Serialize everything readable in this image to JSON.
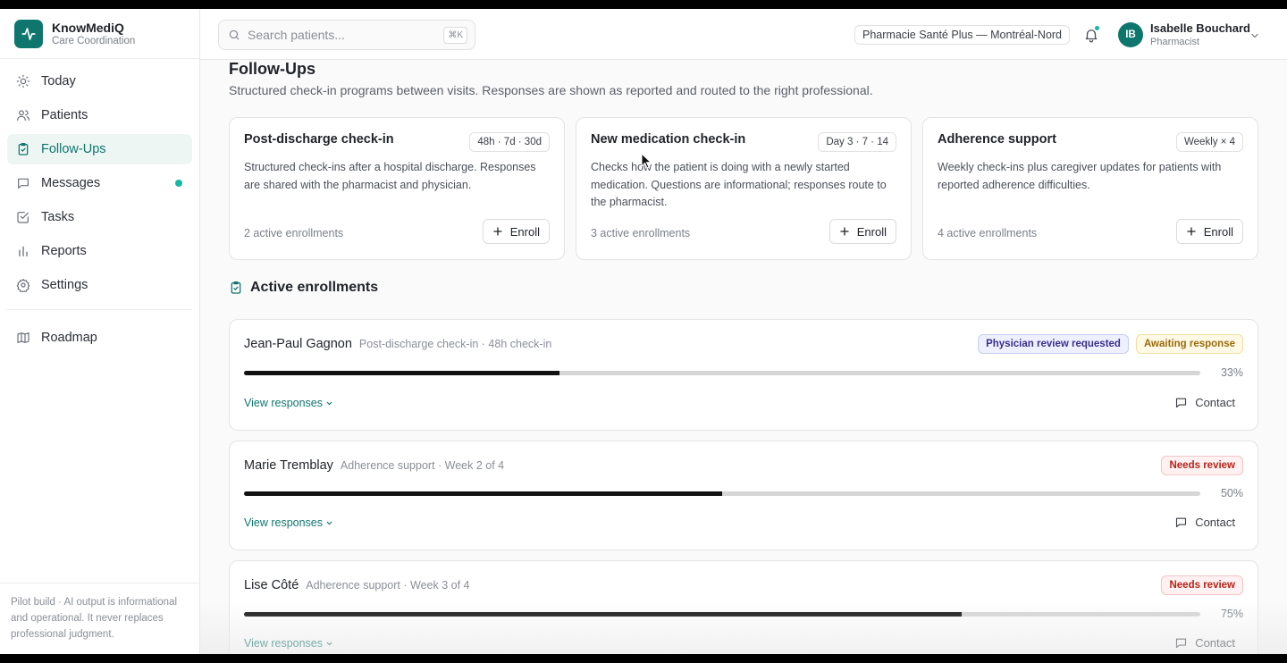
{
  "brand": {
    "name": "KnowMediQ",
    "subtitle": "Care Coordination"
  },
  "sidebar": {
    "items": [
      {
        "label": "Today",
        "icon": "sun-icon"
      },
      {
        "label": "Patients",
        "icon": "users-icon"
      },
      {
        "label": "Follow-Ups",
        "icon": "clipboard-check-icon",
        "active": true
      },
      {
        "label": "Messages",
        "icon": "message-icon",
        "dot": true
      },
      {
        "label": "Tasks",
        "icon": "check-square-icon"
      },
      {
        "label": "Reports",
        "icon": "bar-chart-icon"
      },
      {
        "label": "Settings",
        "icon": "gear-icon"
      }
    ],
    "secondary": [
      {
        "label": "Roadmap",
        "icon": "map-icon"
      }
    ],
    "footer_note": "Pilot build · AI output is informational and operational. It never replaces professional judgment."
  },
  "header": {
    "search_placeholder": "Search patients...",
    "search_shortcut": "⌘K",
    "pharmacy": "Pharmacie Santé Plus — Montréal-Nord",
    "user": {
      "initials": "IB",
      "name": "Isabelle Bouchard",
      "role": "Pharmacist"
    }
  },
  "page": {
    "title": "Follow-Ups",
    "subtitle": "Structured check-in programs between visits. Responses are shown as reported and routed to the right professional."
  },
  "programs": [
    {
      "title": "Post-discharge check-in",
      "badge": "48h · 7d · 30d",
      "description": "Structured check-ins after a hospital discharge. Responses are shared with the pharmacist and physician.",
      "count": "2 active enrollments",
      "button": "Enroll"
    },
    {
      "title": "New medication check-in",
      "badge": "Day 3 · 7 · 14",
      "description": "Checks how the patient is doing with a newly started medication. Questions are informational; responses route to the pharmacist.",
      "count": "3 active enrollments",
      "button": "Enroll"
    },
    {
      "title": "Adherence support",
      "badge": "Weekly × 4",
      "description": "Weekly check-ins plus caregiver updates for patients with reported adherence difficulties.",
      "count": "4 active enrollments",
      "button": "Enroll"
    }
  ],
  "enrollments_section": {
    "title": "Active enrollments"
  },
  "enrollments": [
    {
      "name": "Jean-Paul Gagnon",
      "meta": "Post-discharge check-in · 48h check-in",
      "badges": [
        {
          "label": "Physician review requested",
          "kind": "physician"
        },
        {
          "label": "Awaiting response",
          "kind": "awaiting"
        }
      ],
      "progress": 0.33,
      "progress_label": "33%",
      "view_label": "View responses",
      "contact_label": "Contact"
    },
    {
      "name": "Marie Tremblay",
      "meta": "Adherence support · Week 2 of 4",
      "badges": [
        {
          "label": "Needs review",
          "kind": "review"
        }
      ],
      "progress": 0.5,
      "progress_label": "50%",
      "view_label": "View responses",
      "contact_label": "Contact"
    },
    {
      "name": "Lise Côté",
      "meta": "Adherence support · Week 3 of 4",
      "badges": [
        {
          "label": "Needs review",
          "kind": "review"
        }
      ],
      "progress": 0.75,
      "progress_label": "75%",
      "view_label": "View responses",
      "contact_label": "Contact"
    }
  ],
  "colors": {
    "accent": "#0f766e",
    "dot": "#14b8a6"
  }
}
